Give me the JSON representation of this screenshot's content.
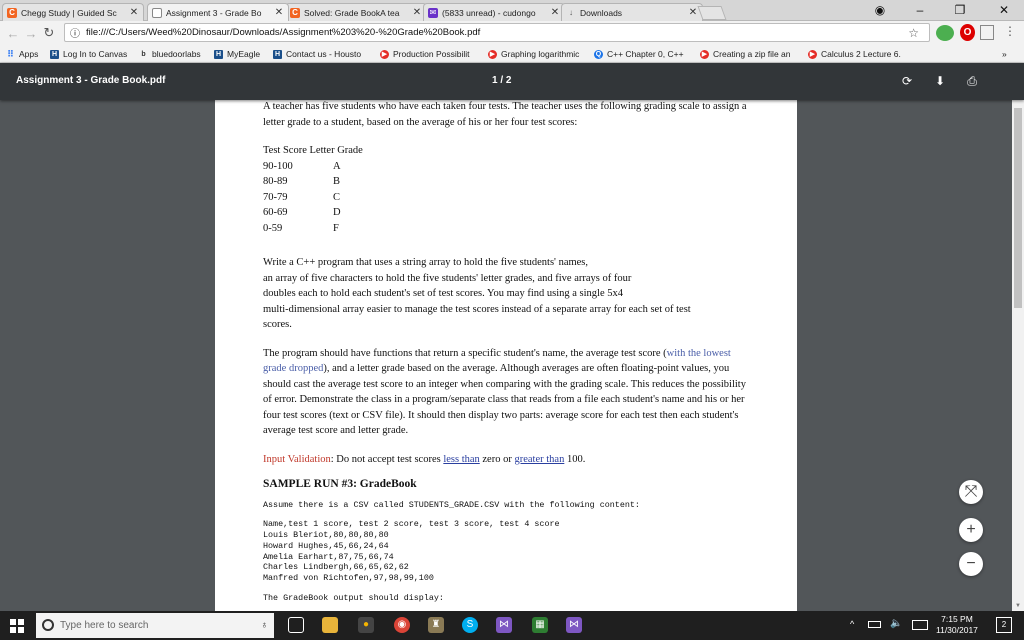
{
  "tabs": [
    {
      "title": "Chegg Study | Guided Sc",
      "icon": "C",
      "color": "#f26522"
    },
    {
      "title": "Assignment 3 - Grade Bo",
      "icon": "",
      "color": "#888888"
    },
    {
      "title": "Solved: Grade BookA tea",
      "icon": "C",
      "color": "#f26522"
    },
    {
      "title": "(5833 unread) - cudongo",
      "icon": "✉",
      "color": "#6a32c9"
    },
    {
      "title": "Downloads",
      "icon": "↓",
      "color": "#555555"
    }
  ],
  "omnibox": {
    "url": "file:///C:/Users/Weed%20Dinosaur/Downloads/Assignment%203%20-%20Grade%20Book.pdf",
    "info": "ⓘ"
  },
  "bookmarks": [
    {
      "label": "Apps",
      "color": "#4285f4",
      "icon": "⠿"
    },
    {
      "label": "Log In to Canvas",
      "color": "#1b4f8a",
      "icon": "H"
    },
    {
      "label": "bluedoorlabs",
      "color": "#555555",
      "icon": "b"
    },
    {
      "label": "MyEagle",
      "color": "#1b4f8a",
      "icon": "H"
    },
    {
      "label": "Contact us - Housto",
      "color": "#1b4f8a",
      "icon": "H"
    },
    {
      "label": "Production Possibilit",
      "color": "#e52d27",
      "icon": "▶"
    },
    {
      "label": "Graphing logarithmic",
      "color": "#e52d27",
      "icon": "▶"
    },
    {
      "label": "C++ Chapter 0, C++",
      "color": "#1a73e8",
      "icon": "Q"
    },
    {
      "label": "Creating a zip file an",
      "color": "#e52d27",
      "icon": "▶"
    },
    {
      "label": "Calculus 2 Lecture 6.",
      "color": "#e52d27",
      "icon": "▶"
    }
  ],
  "bookmarks_more": "»",
  "pdf": {
    "title": "Assignment 3 - Grade Book.pdf",
    "page": "1 / 2"
  },
  "doc": {
    "intro": "A teacher has five students who have each taken four tests. The teacher uses the following grading scale to assign a letter grade to a student, based on the average of his or her four test scores:",
    "table_header": "Test Score Letter Grade",
    "grades": [
      {
        "range": "90-100",
        "letter": "A"
      },
      {
        "range": "80-89",
        "letter": "B"
      },
      {
        "range": "70-79",
        "letter": "C"
      },
      {
        "range": "60-69",
        "letter": "D"
      },
      {
        "range": "0-59",
        "letter": "F"
      }
    ],
    "p2_l1": "Write a C++ program that uses a string array to hold the five students' names,",
    "p2_l2": "an array of five characters to hold the five students' letter grades, and five arrays of four",
    "p2_l3": "doubles each to hold each student's set of test scores. You may find using a single 5x4",
    "p2_l4": "multi-dimensional array easier to manage the test scores instead of a separate array for each set of test",
    "p2_l5": "scores.",
    "p3_a": "The program should have functions that return a specific student's name, the average test score (",
    "p3_blue": "with the lowest grade dropped",
    "p3_b": "), and a letter grade based on the average. Although averages are often floating-point values, you should cast the average test score to an integer when comparing with the grading scale. This reduces the possibility of error. Demonstrate the class in a program/separate class that reads from a file each student's name  and his or her four test scores (text or CSV file). It should then display two parts: average score for each test then each student's average test score and letter grade.",
    "iv_label": "Input Validation",
    "iv_a": ": Do not accept test scores ",
    "iv_less": "less than",
    "iv_b": " zero or ",
    "iv_greater": "greater than",
    "iv_c": " 100.",
    "sample_heading": "SAMPLE RUN #3: GradeBook",
    "assume": "Assume there is a CSV called STUDENTS_GRADE.CSV with the following content:",
    "csv": [
      "Name,test 1 score, test 2 score, test 3 score, test 4 score",
      "Louis Bleriot,80,80,80,80",
      "Howard Hughes,45,66,24,64",
      "Amelia Earhart,87,75,66,74",
      "Charles Lindbergh,66,65,62,62",
      "Manfred von Richtofen,97,98,99,100"
    ],
    "display": "The GradeBook output should display:"
  },
  "taskbar": {
    "search_placeholder": "Type here to search",
    "time": "7:15 PM",
    "date": "11/30/2017",
    "notifications": "2"
  }
}
